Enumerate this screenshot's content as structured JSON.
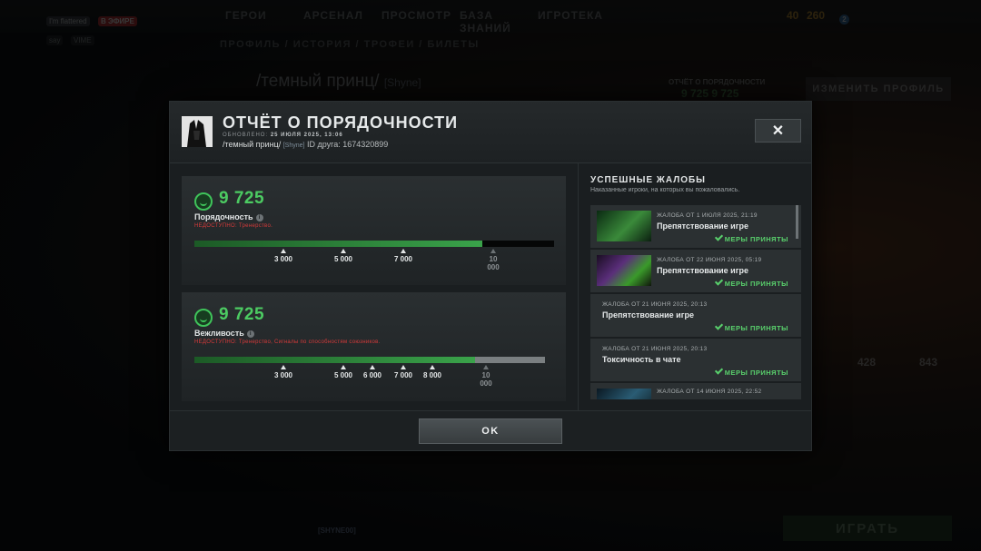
{
  "background": {
    "user_status": "I'm flattered",
    "live_badge": "В ЭФИРЕ",
    "mini_tags": [
      "say",
      "VIME"
    ],
    "top_nav": [
      "ГЕРОИ",
      "АРСЕНАЛ",
      "ПРОСМОТР",
      "БАЗА ЗНАНИЙ",
      "ИГРОТЕКА"
    ],
    "currency_a": "40",
    "currency_b": "260",
    "friends_count": "2",
    "sub_nav": "ПРОФИЛЬ / ИСТОРИЯ / ТРОФЕИ / БИЛЕТЫ",
    "profile_title": "/темный принц/",
    "profile_tag": "[Shyne]",
    "conduct_label": "ОТЧЁТ О ПОРЯДОЧНОСТИ",
    "conduct_scores": "9 725  9 725",
    "edit_profile": "ИЗМЕНИТЬ ПРОФИЛЬ",
    "stat_a": "428",
    "stat_b": "843",
    "chat_name": "[SHYNE00]",
    "play_button": "ИГРАТЬ"
  },
  "modal": {
    "title": "ОТЧЁТ О ПОРЯДОЧНОСТИ",
    "updated_label": "ОБНОВЛЕНО:",
    "updated_value": "25 ИЮЛЯ 2025, 13:06",
    "player_name": "/темный принц/",
    "player_tag": "[Shyne]",
    "friend_id": "ID друга: 1674320899",
    "close_symbol": "✕",
    "ok_label": "OK"
  },
  "conduct": {
    "score": "9 725",
    "label": "Порядочность",
    "info": "i",
    "warning": "НЕДОСТУПНО: Тренерство.",
    "fill": 0.8,
    "ticks": [
      "3 000",
      "5 000",
      "7 000",
      "10 000"
    ]
  },
  "behavior": {
    "score": "9 725",
    "label": "Вежливость",
    "info": "i",
    "warning": "НЕДОСТУПНО: Тренерство, Сигналы по способностям союзников.",
    "fill": 0.8,
    "ticks": [
      "3 000",
      "5 000",
      "6 000",
      "7 000",
      "8 000",
      "10 000"
    ]
  },
  "reports": {
    "title": "УСПЕШНЫЕ ЖАЛОБЫ",
    "subtitle": "Наказанные игроки, на которых вы пожаловались.",
    "items": [
      {
        "date": "ЖАЛОБА ОТ 1 ИЮЛЯ 2025, 21:19",
        "kind": "Препятствование игре",
        "status": "МЕРЫ ПРИНЯТЫ"
      },
      {
        "date": "ЖАЛОБА ОТ 22 ИЮНЯ 2025, 05:19",
        "kind": "Препятствование игре",
        "status": "МЕРЫ ПРИНЯТЫ"
      },
      {
        "date": "ЖАЛОБА ОТ 21 ИЮНЯ 2025, 20:13",
        "kind": "Препятствование игре",
        "status": "МЕРЫ ПРИНЯТЫ"
      },
      {
        "date": "ЖАЛОБА ОТ 21 ИЮНЯ 2025, 20:13",
        "kind": "Токсичность в чате",
        "status": "МЕРЫ ПРИНЯТЫ"
      },
      {
        "date": "ЖАЛОБА ОТ 14 ИЮНЯ 2025, 22:52",
        "kind": "",
        "status": ""
      }
    ]
  },
  "colors": {
    "accent_green": "#4ccb62",
    "warning_red": "#d63a3a",
    "bar_fill": "#3aa34a"
  }
}
